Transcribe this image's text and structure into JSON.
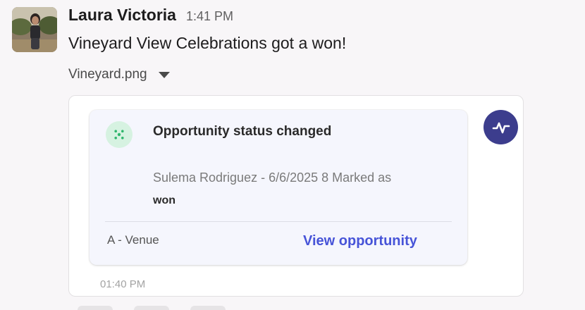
{
  "message": {
    "author": "Laura Victoria",
    "time": "1:41 PM",
    "text": "Vineyard View Celebrations got a won!"
  },
  "attachment": {
    "file_name": "Vineyard.png"
  },
  "preview": {
    "card": {
      "title": "Opportunity status changed",
      "description": "Sulema Rodriguez - 6/6/2025 8 Marked as",
      "status": "won",
      "tag": "A - Venue",
      "link_label": "View opportunity"
    },
    "timestamp": "01:40 PM"
  },
  "icons": {
    "card_icon": "sparkle-icon",
    "app_badge": "activity-pulse-icon",
    "file_caret": "caret-down-icon"
  },
  "colors": {
    "link": "#4754d8",
    "app_badge": "#3c3d8d",
    "card_icon_bg": "#d6f2e1",
    "card_icon_fg": "#2fb66c"
  }
}
